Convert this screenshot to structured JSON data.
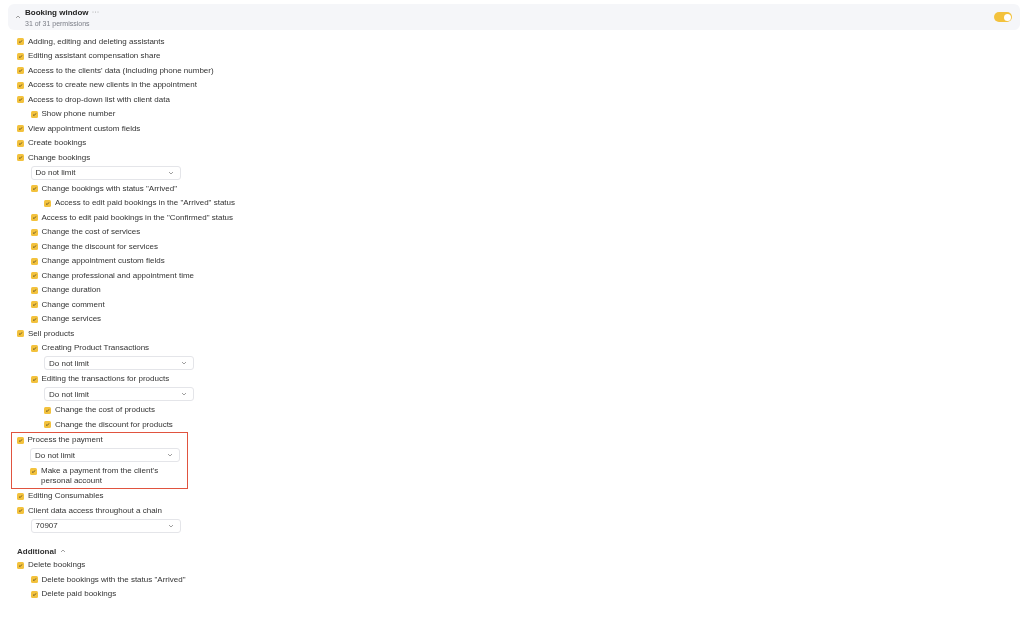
{
  "panel": {
    "title": "Booking window",
    "subtitle": "31 of 31 permissions",
    "expanded": true,
    "enabled": true
  },
  "permissions": [
    {
      "kind": "checkbox",
      "label": "Adding, editing and deleting assistants",
      "checked": true,
      "highlighted": false
    },
    {
      "kind": "checkbox",
      "label": "Editing assistant compensation share",
      "checked": true,
      "highlighted": false
    },
    {
      "kind": "checkbox",
      "label": "Access to the clients' data (Including phone number)",
      "checked": true,
      "highlighted": false
    },
    {
      "kind": "checkbox",
      "label": "Access to create new clients in the appointment",
      "checked": true,
      "highlighted": false
    },
    {
      "kind": "checkbox",
      "label": "Access to drop-down list with client data",
      "checked": true,
      "highlighted": false,
      "children": [
        {
          "kind": "checkbox",
          "label": "Show phone number",
          "checked": true
        }
      ]
    },
    {
      "kind": "checkbox",
      "label": "View appointment custom fields",
      "checked": true,
      "highlighted": false
    },
    {
      "kind": "checkbox",
      "label": "Create bookings",
      "checked": true,
      "highlighted": false
    },
    {
      "kind": "checkbox",
      "label": "Change bookings",
      "checked": true,
      "highlighted": false,
      "children": [
        {
          "kind": "select",
          "value": "Do not limit"
        },
        {
          "kind": "checkbox",
          "label": "Change bookings with status \"Arrived\"",
          "checked": true,
          "children": [
            {
              "kind": "checkbox",
              "label": "Access to edit paid bookings in the \"Arrived\" status",
              "checked": true
            }
          ]
        },
        {
          "kind": "checkbox",
          "label": "Access to edit paid bookings in the \"Confirmed\" status",
          "checked": true
        },
        {
          "kind": "checkbox",
          "label": "Change the cost of services",
          "checked": true
        },
        {
          "kind": "checkbox",
          "label": "Change the discount for services",
          "checked": true
        },
        {
          "kind": "checkbox",
          "label": "Change appointment custom fields",
          "checked": true
        },
        {
          "kind": "checkbox",
          "label": "Change professional and appointment time",
          "checked": true
        },
        {
          "kind": "checkbox",
          "label": "Change duration",
          "checked": true
        },
        {
          "kind": "checkbox",
          "label": "Change comment",
          "checked": true
        },
        {
          "kind": "checkbox",
          "label": "Change services",
          "checked": true
        }
      ]
    },
    {
      "kind": "checkbox",
      "label": "Sell products",
      "checked": true,
      "highlighted": false,
      "children": [
        {
          "kind": "checkbox",
          "label": "Creating Product Transactions",
          "checked": true,
          "children": [
            {
              "kind": "select",
              "value": "Do not limit"
            }
          ]
        },
        {
          "kind": "checkbox",
          "label": "Editing the transactions for products",
          "checked": true,
          "children": [
            {
              "kind": "select",
              "value": "Do not limit"
            },
            {
              "kind": "checkbox",
              "label": "Change the cost of products",
              "checked": true
            },
            {
              "kind": "checkbox",
              "label": "Change the discount for products",
              "checked": true
            }
          ]
        }
      ]
    },
    {
      "kind": "checkbox",
      "label": "Process the payment",
      "checked": true,
      "highlighted": true,
      "children": [
        {
          "kind": "select",
          "value": "Do not limit"
        },
        {
          "kind": "checkbox",
          "label": "Make a payment from the client's personal account",
          "checked": true
        }
      ]
    },
    {
      "kind": "checkbox",
      "label": "Editing Consumables",
      "checked": true,
      "highlighted": false
    },
    {
      "kind": "checkbox",
      "label": "Client data access throughout a chain",
      "checked": true,
      "highlighted": false,
      "children": [
        {
          "kind": "select",
          "value": "70907"
        }
      ]
    }
  ],
  "sections": [
    {
      "title": "Additional",
      "expanded": true,
      "permissions": [
        {
          "kind": "checkbox",
          "label": "Delete bookings",
          "checked": true,
          "children": [
            {
              "kind": "checkbox",
              "label": "Delete bookings with the status \"Arrived\"",
              "checked": true
            },
            {
              "kind": "checkbox",
              "label": "Delete paid bookings",
              "checked": true
            }
          ]
        }
      ]
    }
  ]
}
